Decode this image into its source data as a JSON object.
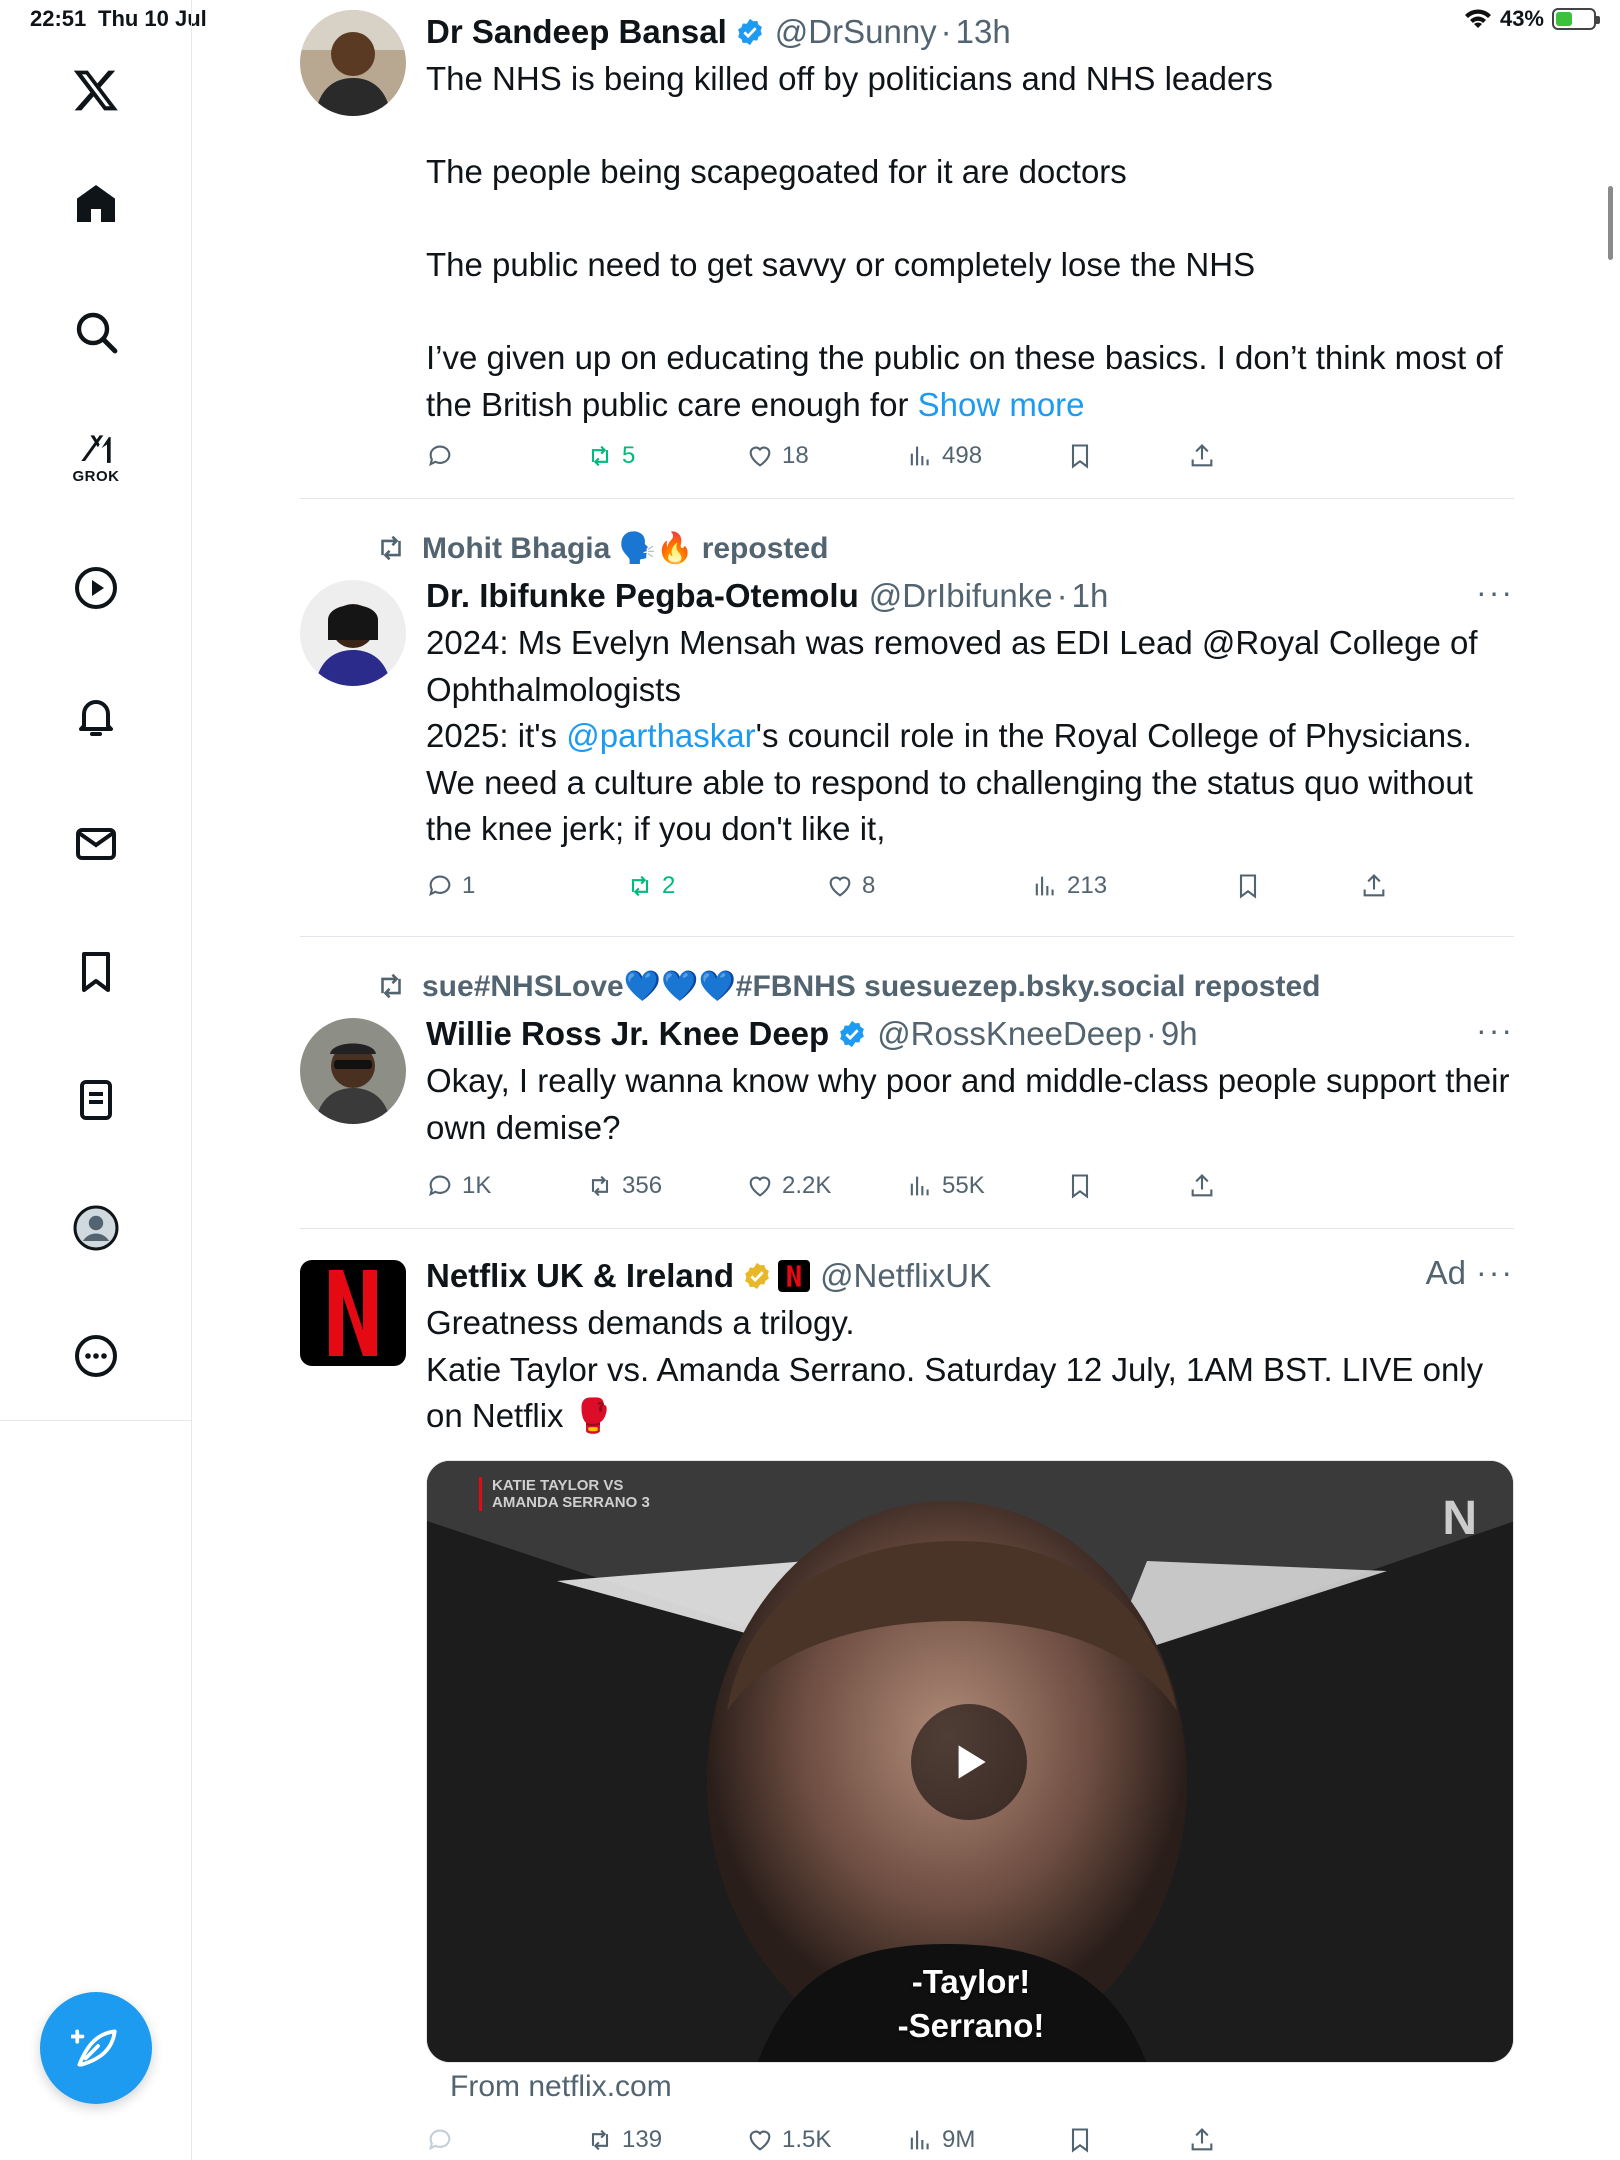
{
  "status_bar": {
    "time": "22:51",
    "date": "Thu 10 Jul",
    "battery": "43%",
    "battery_level": 0.43
  },
  "sidebar": {
    "grok_label": "GROK"
  },
  "tweets": [
    {
      "name": "Dr Sandeep Bansal",
      "handle": "@DrSunny",
      "time": "13h",
      "text": "The NHS is being killed off by politicians and NHS leaders\n\nThe people being scapegoated for it are doctors\n\nThe public need to get savvy or completely lose the NHS\n\nI’ve given up on educating the public on these basics. I don’t think most of the British public care enough for ",
      "show_more": "Show more",
      "stats": {
        "replies": "",
        "reposts": "5",
        "likes": "18",
        "views": "498"
      }
    },
    {
      "repost_by": "Mohit Bhagia 🗣️🔥 reposted",
      "name": "Dr. Ibifunke Pegba-Otemolu",
      "handle": "@DrIbifunke",
      "time": "1h",
      "text_a": "2024: Ms Evelyn Mensah was removed as EDI Lead @Royal College of Ophthalmologists\n2025: it's ",
      "mention": "@parthaskar",
      "text_b": "'s council role in the Royal College of Physicians. We need a culture able to respond to challenging the status quo without the knee jerk; if you don't like it,",
      "stats": {
        "replies": "1",
        "reposts": "2",
        "likes": "8",
        "views": "213"
      }
    },
    {
      "repost_by": "sue#NHSLove💙💙💙#FBNHS suesuezep.bsky.social reposted",
      "name": "Willie Ross Jr. Knee Deep",
      "handle": "@RossKneeDeep",
      "time": "9h",
      "text": "Okay, I really wanna know why poor and middle-class people support their own demise?",
      "stats": {
        "replies": "1K",
        "reposts": "356",
        "likes": "2.2K",
        "views": "55K"
      }
    },
    {
      "name": "Netflix UK & Ireland",
      "handle": "@NetflixUK",
      "ad_label": "Ad",
      "text": "Greatness demands a trilogy.\nKatie Taylor vs. Amanda Serrano. Saturday 12 July, 1AM BST. LIVE only on Netflix 🥊",
      "media_caption_1": "KATIE TAYLOR VS",
      "media_caption_2": "AMANDA SERRANO 3",
      "media_logo": "N",
      "subtitle_1": "-Taylor!",
      "subtitle_2": "-Serrano!",
      "from_link": "From netflix.com",
      "stats": {
        "replies": "",
        "reposts": "139",
        "likes": "1.5K",
        "views": "9M"
      }
    }
  ],
  "colors": {
    "accent": "#1d9bf0",
    "repost_green": "#00ba7c",
    "muted": "#536471",
    "netflix_red": "#e50914"
  }
}
